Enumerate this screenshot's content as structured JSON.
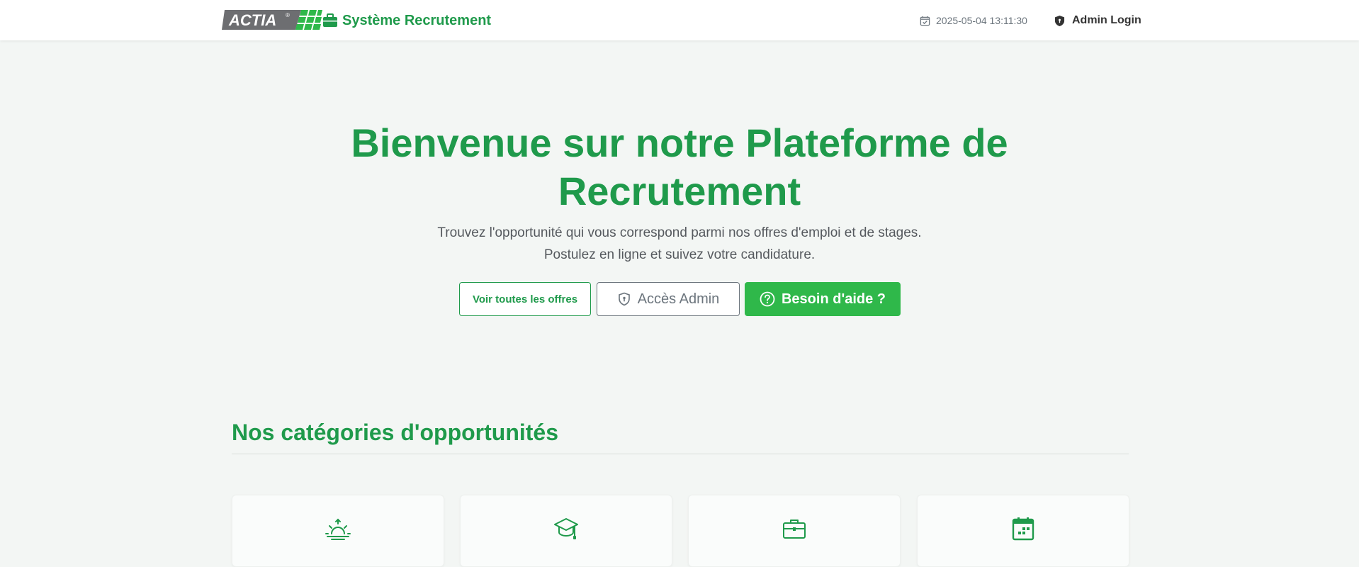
{
  "header": {
    "logo_text": "ACTIA",
    "logo_mark": "®",
    "brand_icon": "briefcase-icon",
    "brand_label": "Système Recrutement",
    "datetime_icon": "calendar-check-icon",
    "datetime": "2025-05-04 13:11:30",
    "admin_icon": "shield-icon",
    "admin_login_label": "Admin Login"
  },
  "hero": {
    "title": "Bienvenue sur notre Plateforme de Recrutement",
    "subtitle": "Trouvez l'opportunité qui vous correspond parmi nos offres d'emploi et de stages. Postulez en ligne et suivez votre candidature.",
    "buttons": {
      "offres_label": "Voir toutes les offres",
      "admin_label": "Accès Admin",
      "admin_icon": "shield-lock-icon",
      "help_label": "Besoin d'aide ?",
      "help_icon": "question-circle-icon"
    }
  },
  "categories": {
    "title": "Nos catégories d'opportunités",
    "cards": [
      {
        "icon": "sunrise-icon"
      },
      {
        "icon": "graduation-cap-icon"
      },
      {
        "icon": "briefcase-icon"
      },
      {
        "icon": "calendar-icon"
      }
    ]
  },
  "colors": {
    "primary_green": "#1f9a4b",
    "button_green": "#2fb84a",
    "secondary_gray": "#6c757d",
    "background": "#f3f6f4"
  }
}
